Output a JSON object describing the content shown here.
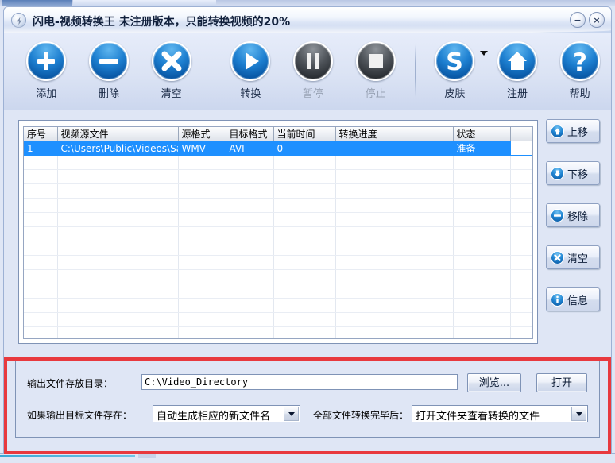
{
  "window": {
    "title": "闪电-视频转换王  未注册版本，只能转换视频的20%",
    "icon": "lightning-bolt-icon",
    "minimize_label": "−",
    "close_label": "×"
  },
  "toolbar": {
    "items": [
      {
        "id": "add",
        "label": "添加",
        "icon": "plus-icon",
        "state": "enabled"
      },
      {
        "id": "delete",
        "label": "删除",
        "icon": "minus-icon",
        "state": "enabled"
      },
      {
        "id": "clear",
        "label": "清空",
        "icon": "x-icon",
        "state": "enabled"
      },
      {
        "id": "convert",
        "label": "转换",
        "icon": "play-icon",
        "state": "enabled"
      },
      {
        "id": "pause",
        "label": "暂停",
        "icon": "pause-icon",
        "state": "disabled"
      },
      {
        "id": "stop",
        "label": "停止",
        "icon": "stop-icon",
        "state": "disabled"
      },
      {
        "id": "skin",
        "label": "皮肤",
        "icon": "letter-s-icon",
        "state": "enabled"
      },
      {
        "id": "register",
        "label": "注册",
        "icon": "home-icon",
        "state": "enabled"
      },
      {
        "id": "help",
        "label": "帮助",
        "icon": "question-mark-icon",
        "state": "enabled"
      }
    ]
  },
  "filelist": {
    "columns": [
      "序号",
      "视频源文件",
      "源格式",
      "目标格式",
      "当前时间",
      "转换进度",
      "状态"
    ],
    "rows": [
      {
        "index": "1",
        "source_file": "C:\\Users\\Public\\Videos\\Sa...",
        "source_format": "WMV",
        "target_format": "AVI",
        "current_time": "0",
        "progress": "",
        "status": "准备",
        "selected": true
      }
    ],
    "empty_row_count": 14
  },
  "side_buttons": [
    {
      "id": "move-up",
      "label": "上移",
      "icon": "arrow-up-icon"
    },
    {
      "id": "move-down",
      "label": "下移",
      "icon": "arrow-down-icon"
    },
    {
      "id": "remove",
      "label": "移除",
      "icon": "minus-icon"
    },
    {
      "id": "clear",
      "label": "清空",
      "icon": "x-icon"
    },
    {
      "id": "info",
      "label": "信息",
      "icon": "info-icon"
    }
  ],
  "settings": {
    "output_dir_label": "输出文件存放目录：",
    "output_dir_value": "C:\\Video_Directory",
    "browse_label": "浏览...",
    "open_label": "打开",
    "exists_label": "如果输出目标文件存在：",
    "exists_value": "自动生成相应的新文件名",
    "after_all_label": "全部文件转换完毕后：",
    "after_all_value": "打开文件夹查看转换的文件"
  },
  "colors": {
    "accent_blue": "#1d7fd0",
    "selection_blue": "#1e90ff",
    "panel_bg": "#dfe6f5",
    "highlight_red": "#e8393e"
  }
}
